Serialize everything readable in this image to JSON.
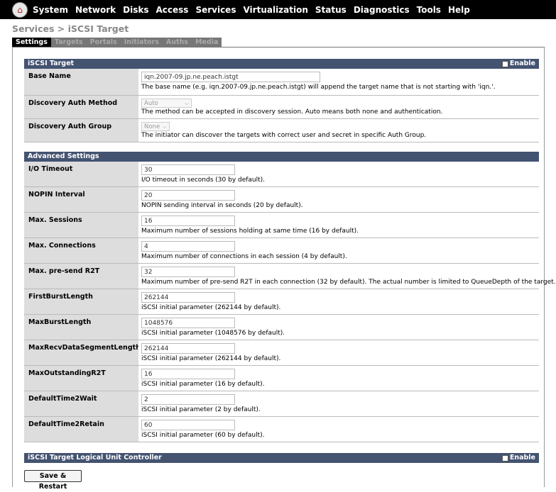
{
  "nav": {
    "items": [
      "System",
      "Network",
      "Disks",
      "Access",
      "Services",
      "Virtualization",
      "Status",
      "Diagnostics",
      "Tools",
      "Help"
    ]
  },
  "breadcrumb": "Services > iSCSI Target",
  "tabs": [
    "Settings",
    "Targets",
    "Portals",
    "Initiators",
    "Auths",
    "Media"
  ],
  "sections": {
    "target": {
      "title": "iSCSI Target",
      "enable_label": "Enable"
    },
    "advanced": {
      "title": "Advanced Settings"
    },
    "luc": {
      "title": "iSCSI Target Logical Unit Controller",
      "enable_label": "Enable"
    }
  },
  "base": {
    "label": "Base Name",
    "value": "iqn.2007-09.jp.ne.peach.istgt",
    "desc": "The base name (e.g. iqn.2007-09.jp.ne.peach.istgt) will append the target name that is not starting with 'iqn.'."
  },
  "disc_method": {
    "label": "Discovery Auth Method",
    "value": "Auto",
    "desc": "The method can be accepted in discovery session. Auto means both none and authentication."
  },
  "disc_group": {
    "label": "Discovery Auth Group",
    "value": "None",
    "desc": "The initiator can discover the targets with correct user and secret in specific Auth Group."
  },
  "adv": [
    {
      "label": "I/O Timeout",
      "value": "30",
      "desc": "I/O timeout in seconds (30 by default)."
    },
    {
      "label": "NOPIN Interval",
      "value": "20",
      "desc": "NOPIN sending interval in seconds (20 by default)."
    },
    {
      "label": "Max. Sessions",
      "value": "16",
      "desc": "Maximum number of sessions holding at same time (16 by default)."
    },
    {
      "label": "Max. Connections",
      "value": "4",
      "desc": "Maximum number of connections in each session (4 by default)."
    },
    {
      "label": "Max. pre-send R2T",
      "value": "32",
      "desc": "Maximum number of pre-send R2T in each connection (32 by default). The actual number is limited to QueueDepth of the target."
    },
    {
      "label": "FirstBurstLength",
      "value": "262144",
      "desc": "iSCSI initial parameter (262144 by default)."
    },
    {
      "label": "MaxBurstLength",
      "value": "1048576",
      "desc": "iSCSI initial parameter (1048576 by default)."
    },
    {
      "label": "MaxRecvDataSegmentLength",
      "value": "262144",
      "desc": "iSCSI initial parameter (262144 by default)."
    },
    {
      "label": "MaxOutstandingR2T",
      "value": "16",
      "desc": "iSCSI initial parameter (16 by default)."
    },
    {
      "label": "DefaultTime2Wait",
      "value": "2",
      "desc": "iSCSI initial parameter (2 by default)."
    },
    {
      "label": "DefaultTime2Retain",
      "value": "60",
      "desc": "iSCSI initial parameter (60 by default)."
    }
  ],
  "save_label": "Save & Restart",
  "colors": {
    "section_header": "#435370",
    "label_bg": "#dddddd",
    "topbar": "#000000"
  },
  "icons": {
    "logo": "freenas-logo-icon",
    "chevron": "chevron-down-icon",
    "checkbox": "checkbox-icon"
  }
}
